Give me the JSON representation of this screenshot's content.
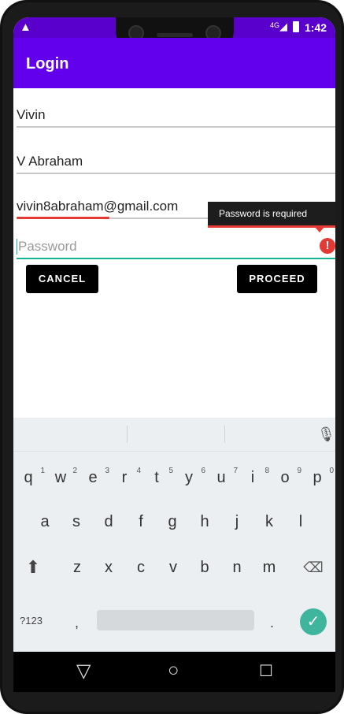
{
  "status": {
    "time": "1:42",
    "network": "4G",
    "alert_icon": "warning-icon"
  },
  "appbar": {
    "title": "Login"
  },
  "form": {
    "first_name": "Vivin",
    "last_name": "V Abraham",
    "email": "vivin8abraham@gmail.com",
    "password_placeholder": "Password",
    "password_error": "Password is required"
  },
  "buttons": {
    "cancel": "CANCEL",
    "proceed": "PROCEED"
  },
  "keyboard": {
    "row1": [
      "q",
      "w",
      "e",
      "r",
      "t",
      "y",
      "u",
      "i",
      "o",
      "p"
    ],
    "row1_nums": [
      "1",
      "2",
      "3",
      "4",
      "5",
      "6",
      "7",
      "8",
      "9",
      "0"
    ],
    "row2": [
      "a",
      "s",
      "d",
      "f",
      "g",
      "h",
      "j",
      "k",
      "l"
    ],
    "row3": [
      "z",
      "x",
      "c",
      "v",
      "b",
      "n",
      "m"
    ],
    "symbols_key": "?123",
    "comma": ",",
    "period": "."
  },
  "colors": {
    "primary": "#6200ee",
    "primary_dark": "#5a00cc",
    "accent": "#15b59a",
    "error": "#e53935"
  }
}
